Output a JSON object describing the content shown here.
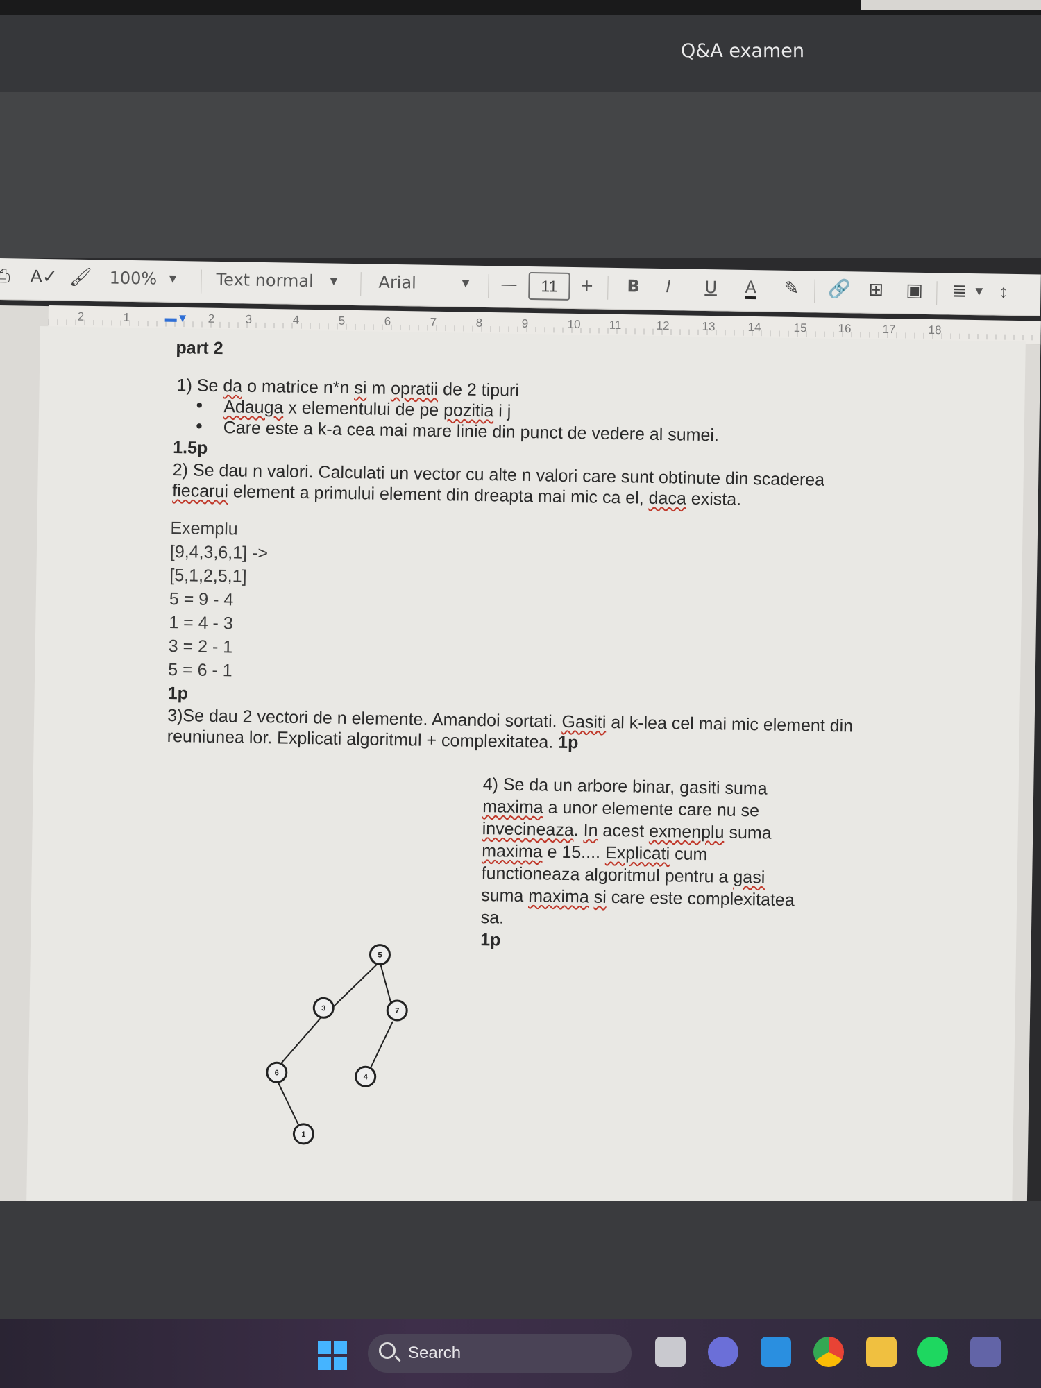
{
  "window": {
    "title": "Q&A examen"
  },
  "toolbar": {
    "zoom": "100%",
    "style": "Text normal",
    "font": "Arial",
    "minus": "—",
    "font_size": "11",
    "plus": "+",
    "bold": "B",
    "italic": "I",
    "underline": "U",
    "text_color": "A"
  },
  "ruler": {
    "ticks": [
      "2",
      "1",
      "1",
      "2",
      "3",
      "4",
      "5",
      "6",
      "7",
      "8",
      "9",
      "10",
      "11",
      "12",
      "13",
      "14",
      "15",
      "16",
      "17",
      "18"
    ]
  },
  "document": {
    "heading": "part 2",
    "q1": {
      "prefix": "1) Se ",
      "w1": "da",
      "mid1": " o matrice n*n ",
      "w2": "si",
      "mid2": " m ",
      "w3": "opratii",
      "suffix": " de 2 tipuri",
      "bullet1_w": "Adauga",
      "bullet1_mid": " x elementului de pe ",
      "bullet1_w2": "pozitia",
      "bullet1_end": " i j",
      "bullet2": "Care este a k-a cea mai mare linie din punct de vedere al sumei.",
      "points": "1.5p"
    },
    "q2": {
      "line1": "2) Se dau n valori. Calculati un vector cu alte n valori care sunt obtinute din scaderea",
      "line2_w": "fiecarui",
      "line2_mid": " element a primului element din dreapta mai mic ca el, ",
      "line2_w2": "daca",
      "line2_end": " exista.",
      "example_label": "Exemplu",
      "ex_in": "[9,4,3,6,1] ->",
      "ex_out": "[5,1,2,5,1]",
      "ex_l1": "5 = 9 - 4",
      "ex_l2": "1 = 4 - 3",
      "ex_l3": "3 = 2 - 1",
      "ex_l4": "5 = 6 - 1",
      "points": "1p"
    },
    "q3": {
      "line1_pre": "3)Se dau 2 vectori de n elemente. Amandoi sortati. ",
      "line1_w": "Gasiti",
      "line1_end": " al k-lea cel mai mic element din",
      "line2": "reuniunea lor.   Explicati algoritmul + complexitatea.",
      "points": "1p"
    },
    "q4": {
      "l1": "4) Se da un arbore binar, gasiti suma",
      "l2_w": "maxima",
      "l2_end": " a unor elemente care nu se",
      "l3_w": "invecineaza",
      "l3_mid": ". ",
      "l3_w2": "In",
      "l3_mid2": " acest ",
      "l3_w3": "exmenplu",
      "l3_end": " suma",
      "l4_w": "maxima",
      "l4_mid": " e 15.... ",
      "l4_w2": "Explicati",
      "l4_end": " cum",
      "l5_pre": "functioneaza algoritmul pentru a ",
      "l5_w": "gasi",
      "l6_pre": "suma ",
      "l6_w": "maxima",
      "l6_mid": " ",
      "l6_w2": "si",
      "l6_end": " care este complexitatea",
      "l7": "sa.",
      "points": "1p"
    },
    "tree": {
      "nodes": [
        "5",
        "3",
        "7",
        "6",
        "4",
        "1"
      ]
    }
  },
  "taskbar": {
    "search_label": "Search"
  }
}
